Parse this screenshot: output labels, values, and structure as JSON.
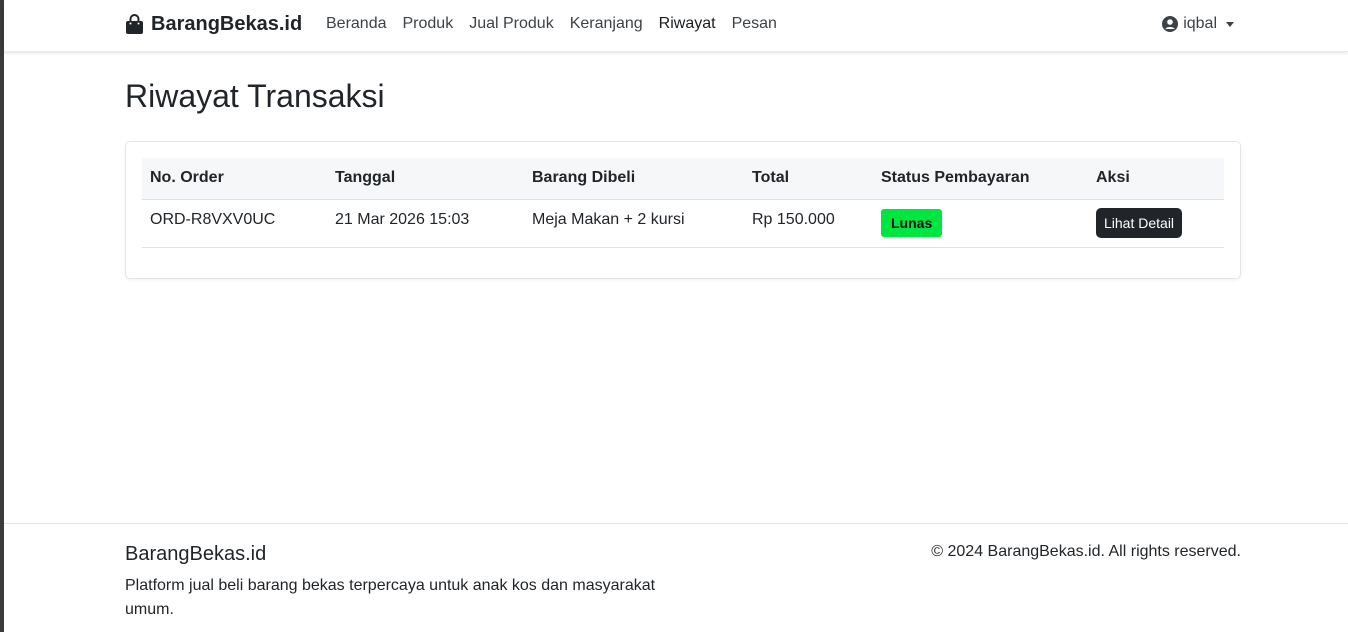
{
  "navbar": {
    "brand": "BarangBekas.id",
    "brand_icon": "shopping-bag-icon",
    "links": [
      "Beranda",
      "Produk",
      "Jual Produk",
      "Keranjang",
      "Riwayat",
      "Pesan"
    ],
    "active_link": "Riwayat",
    "user": "iqbal",
    "user_icon": "user-circle-icon"
  },
  "page": {
    "title": "Riwayat Transaksi"
  },
  "table": {
    "headers": [
      "No. Order",
      "Tanggal",
      "Barang Dibeli",
      "Total",
      "Status Pembayaran",
      "Aksi"
    ],
    "rows": [
      {
        "order_no": "ORD-R8VXV0UC",
        "date": "21 Mar 2026 15:03",
        "item": "Meja Makan + 2 kursi",
        "total": "Rp 150.000",
        "status": "Lunas",
        "action": "Lihat Detail"
      }
    ]
  },
  "footer": {
    "title": "BarangBekas.id",
    "description": "Platform jual beli barang bekas terpercaya untuk anak kos dan masyarakat umum.",
    "copyright": "© 2024 BarangBekas.id. All rights reserved."
  },
  "colors": {
    "status_paid": "#00e640",
    "button_dark": "#212529"
  }
}
